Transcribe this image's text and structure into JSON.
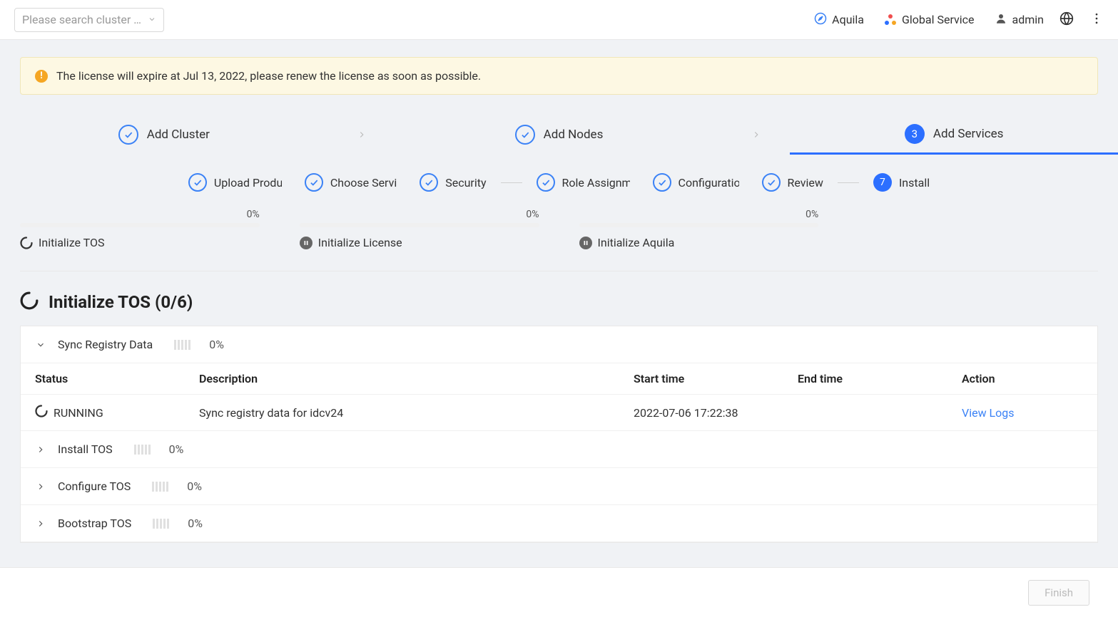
{
  "header": {
    "search_placeholder": "Please search cluster …",
    "aquila": "Aquila",
    "global_service": "Global Service",
    "admin": "admin"
  },
  "alert": {
    "text": "The license will expire at Jul 13, 2022, please renew the license as soon as possible."
  },
  "main_steps": {
    "s1": "Add Cluster",
    "s2": "Add Nodes",
    "s3_num": "3",
    "s3": "Add Services"
  },
  "sub_steps": {
    "s1": "Upload Produ",
    "s2": "Choose Servi",
    "s3": "Security",
    "s4": "Role Assignm",
    "s5": "Configuration",
    "s6": "Review",
    "s7_num": "7",
    "s7": "Install"
  },
  "progress": {
    "p1_pct": "0%",
    "p1_label": "Initialize TOS",
    "p2_pct": "0%",
    "p2_label": "Initialize License",
    "p3_pct": "0%",
    "p3_label": "Initialize Aquila"
  },
  "section": {
    "title": "Initialize TOS (0/6)"
  },
  "groups": {
    "g1_name": "Sync Registry Data",
    "g1_pct": "0%",
    "g2_name": "Install TOS",
    "g2_pct": "0%",
    "g3_name": "Configure TOS",
    "g3_pct": "0%",
    "g4_name": "Bootstrap TOS",
    "g4_pct": "0%"
  },
  "table": {
    "h_status": "Status",
    "h_desc": "Description",
    "h_start": "Start time",
    "h_end": "End time",
    "h_action": "Action",
    "r1_status": "RUNNING",
    "r1_desc": "Sync registry data for idcv24",
    "r1_start": "2022-07-06 17:22:38",
    "r1_end": "",
    "r1_action": "View Logs"
  },
  "footer": {
    "finish": "Finish"
  }
}
